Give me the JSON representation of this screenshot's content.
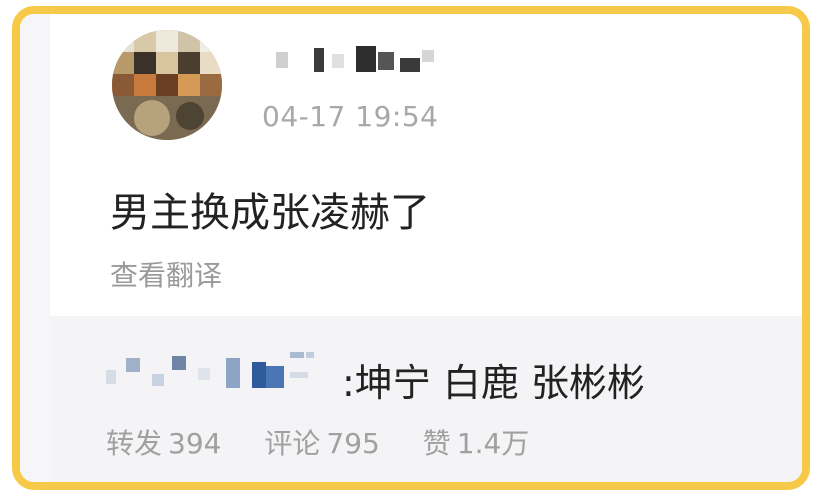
{
  "post": {
    "timestamp": "04-17 19:54",
    "content": "男主换成张凌赫了",
    "translate_label": "查看翻译"
  },
  "repost": {
    "text": ":坤宁 白鹿 张彬彬",
    "stats": {
      "repost_label": "转发",
      "repost_count": "394",
      "comment_label": "评论",
      "comment_count": "795",
      "like_label": "赞",
      "like_count": "1.4万"
    }
  },
  "colors": {
    "frame": "#f7c948",
    "repost_bg": "#f4f4f6",
    "muted_text": "#a8a8a8"
  }
}
